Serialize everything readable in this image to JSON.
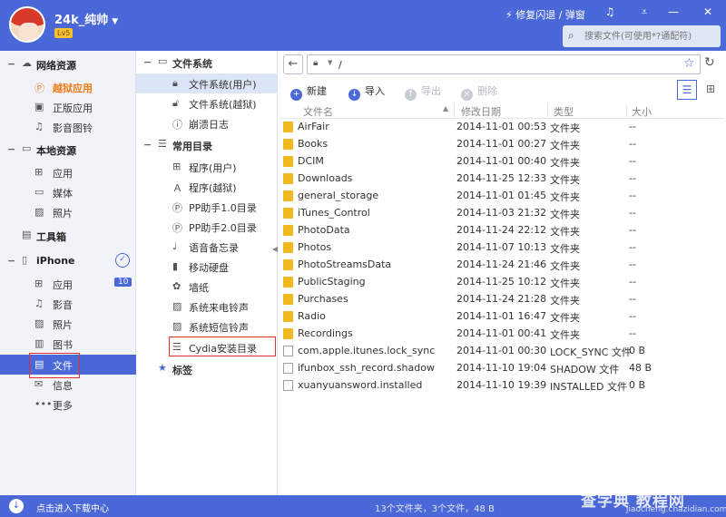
{
  "titlebar": {
    "username": "24k_纯帅",
    "level": "Lv5",
    "flash_label": "修复闪退 / 弹窗",
    "search_placeholder": "搜索文件(可使用*?通配符)"
  },
  "leftnav": {
    "sections": [
      {
        "label": "网络资源",
        "items": [
          {
            "label": "越狱应用",
            "icon": "p-icon"
          },
          {
            "label": "正版应用",
            "icon": "bag-icon"
          },
          {
            "label": "影音图铃",
            "icon": "music-icon"
          }
        ]
      },
      {
        "label": "本地资源",
        "items": [
          {
            "label": "应用",
            "icon": "grid-icon"
          },
          {
            "label": "媒体",
            "icon": "video-icon"
          },
          {
            "label": "照片",
            "icon": "photo-icon"
          }
        ]
      },
      {
        "label": "工具箱"
      },
      {
        "label": "iPhone",
        "items": [
          {
            "label": "应用",
            "badge": "10",
            "icon": "grid-icon"
          },
          {
            "label": "影音",
            "icon": "music-icon"
          },
          {
            "label": "照片",
            "icon": "photo-icon"
          },
          {
            "label": "图书",
            "icon": "book-icon"
          },
          {
            "label": "文件",
            "icon": "file-icon"
          },
          {
            "label": "信息",
            "icon": "message-icon"
          },
          {
            "label": "更多",
            "icon": "more-icon"
          }
        ]
      }
    ]
  },
  "midnav": {
    "filesystem_title": "文件系统",
    "filesystem_items": [
      "文件系统(用户)",
      "文件系统(越狱)",
      "崩溃日志"
    ],
    "common_title": "常用目录",
    "common_items": [
      "程序(用户)",
      "程序(越狱)",
      "PP助手1.0目录",
      "PP助手2.0目录",
      "语音备忘录",
      "移动硬盘",
      "墙纸",
      "系统来电铃声",
      "系统短信铃声",
      "Cydia安装目录"
    ],
    "tags_label": "标签"
  },
  "pathbar": {
    "path": "/"
  },
  "toolbar": {
    "new": "新建",
    "import": "导入",
    "export": "导出",
    "delete": "删除"
  },
  "table": {
    "headers": [
      "文件名",
      "修改日期",
      "类型",
      "大小"
    ],
    "rows": [
      {
        "name": "AirFair",
        "date": "2014-11-01 00:53",
        "type": "文件夹",
        "size": "--",
        "kind": "folder"
      },
      {
        "name": "Books",
        "date": "2014-11-01 00:27",
        "type": "文件夹",
        "size": "--",
        "kind": "folder"
      },
      {
        "name": "DCIM",
        "date": "2014-11-01 00:40",
        "type": "文件夹",
        "size": "--",
        "kind": "folder"
      },
      {
        "name": "Downloads",
        "date": "2014-11-25 12:33",
        "type": "文件夹",
        "size": "--",
        "kind": "folder"
      },
      {
        "name": "general_storage",
        "date": "2014-11-01 01:45",
        "type": "文件夹",
        "size": "--",
        "kind": "folder"
      },
      {
        "name": "iTunes_Control",
        "date": "2014-11-03 21:32",
        "type": "文件夹",
        "size": "--",
        "kind": "folder"
      },
      {
        "name": "PhotoData",
        "date": "2014-11-24 22:12",
        "type": "文件夹",
        "size": "--",
        "kind": "folder"
      },
      {
        "name": "Photos",
        "date": "2014-11-07 10:13",
        "type": "文件夹",
        "size": "--",
        "kind": "folder"
      },
      {
        "name": "PhotoStreamsData",
        "date": "2014-11-24 21:46",
        "type": "文件夹",
        "size": "--",
        "kind": "folder"
      },
      {
        "name": "PublicStaging",
        "date": "2014-11-25 10:12",
        "type": "文件夹",
        "size": "--",
        "kind": "folder"
      },
      {
        "name": "Purchases",
        "date": "2014-11-24 21:28",
        "type": "文件夹",
        "size": "--",
        "kind": "folder"
      },
      {
        "name": "Radio",
        "date": "2014-11-01 16:47",
        "type": "文件夹",
        "size": "--",
        "kind": "folder"
      },
      {
        "name": "Recordings",
        "date": "2014-11-01 00:41",
        "type": "文件夹",
        "size": "--",
        "kind": "folder"
      },
      {
        "name": "com.apple.itunes.lock_sync",
        "date": "2014-11-01 00:30",
        "type": "LOCK_SYNC 文件",
        "size": "0 B",
        "kind": "file"
      },
      {
        "name": "ifunbox_ssh_record.shadow",
        "date": "2014-11-10 19:04",
        "type": "SHADOW 文件",
        "size": "48 B",
        "kind": "file"
      },
      {
        "name": "xuanyuansword.installed",
        "date": "2014-11-10 19:39",
        "type": "INSTALLED 文件",
        "size": "0 B",
        "kind": "file"
      }
    ]
  },
  "statusbar": {
    "download_label": "点击进入下载中心",
    "summary": "13个文件夹，3个文件，48 B"
  },
  "watermark": {
    "main": "查字典 教程网",
    "url": "jiaocheng.chazidian.com"
  }
}
